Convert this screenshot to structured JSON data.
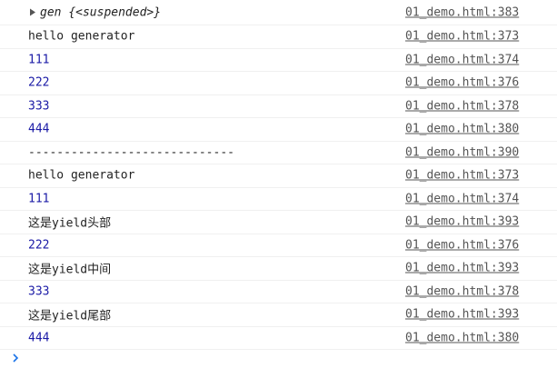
{
  "console": {
    "rows": [
      {
        "kind": "object",
        "name": "gen",
        "value": "{<suspended>}",
        "source": "01_demo.html:383"
      },
      {
        "kind": "text",
        "text": "hello generator",
        "source": "01_demo.html:373"
      },
      {
        "kind": "number",
        "text": "111",
        "source": "01_demo.html:374"
      },
      {
        "kind": "number",
        "text": "222",
        "source": "01_demo.html:376"
      },
      {
        "kind": "number",
        "text": "333",
        "source": "01_demo.html:378"
      },
      {
        "kind": "number",
        "text": "444",
        "source": "01_demo.html:380"
      },
      {
        "kind": "text",
        "text": "-----------------------------",
        "source": "01_demo.html:390"
      },
      {
        "kind": "text",
        "text": "hello generator",
        "source": "01_demo.html:373"
      },
      {
        "kind": "number",
        "text": "111",
        "source": "01_demo.html:374"
      },
      {
        "kind": "text",
        "text": "这是yield头部",
        "source": "01_demo.html:393"
      },
      {
        "kind": "number",
        "text": "222",
        "source": "01_demo.html:376"
      },
      {
        "kind": "text",
        "text": "这是yield中间",
        "source": "01_demo.html:393"
      },
      {
        "kind": "number",
        "text": "333",
        "source": "01_demo.html:378"
      },
      {
        "kind": "text",
        "text": "这是yield尾部",
        "source": "01_demo.html:393"
      },
      {
        "kind": "number",
        "text": "444",
        "source": "01_demo.html:380"
      }
    ],
    "prompt": {
      "icon": "chevron-right-icon",
      "value": "",
      "color": "#1a73e8"
    }
  }
}
